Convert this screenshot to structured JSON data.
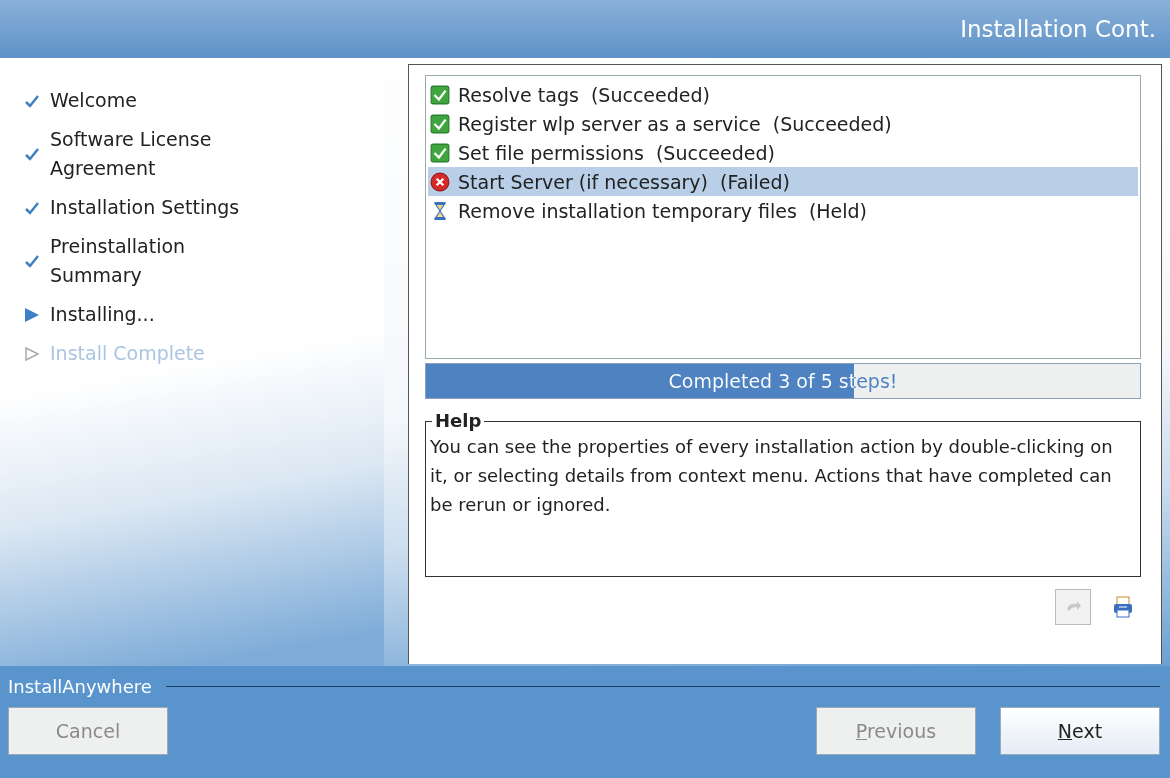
{
  "header": {
    "title": "Installation Cont."
  },
  "steps": [
    {
      "label": "Welcome",
      "kind": "done"
    },
    {
      "label": "Software License Agreement",
      "kind": "done"
    },
    {
      "label": "Installation Settings",
      "kind": "done"
    },
    {
      "label": "Preinstallation Summary",
      "kind": "done"
    },
    {
      "label": "Installing...",
      "kind": "current"
    },
    {
      "label": "Install Complete",
      "kind": "pending"
    }
  ],
  "actions": [
    {
      "label": "Resolve tags  (Succeeded)",
      "kind": "succeeded",
      "selected": false
    },
    {
      "label": "Register wlp server as a service  (Succeeded)",
      "kind": "succeeded",
      "selected": false
    },
    {
      "label": "Set file permissions  (Succeeded)",
      "kind": "succeeded",
      "selected": false
    },
    {
      "label": "Start Server (if necessary)  (Failed)",
      "kind": "failed",
      "selected": true
    },
    {
      "label": "Remove installation temporary files  (Held)",
      "kind": "held",
      "selected": false
    }
  ],
  "progress": {
    "text": "Completed 3 of 5 steps!",
    "level": 0.6
  },
  "help": {
    "title": "Help",
    "text": "You can see the properties of every installation action by double-clicking on it, or selecting details from context menu. Actions that have completed can be rerun or ignored."
  },
  "tools": [
    {
      "kind": "rerun",
      "disabled": true
    },
    {
      "kind": "details",
      "disabled": false
    }
  ],
  "footer": {
    "brand": "InstallAnywhere"
  },
  "buttons": {
    "cancel": {
      "label": "Cancel",
      "disabled": true
    },
    "previous": {
      "label": "Previous",
      "disabled": true
    },
    "next": {
      "label": "Next",
      "disabled": false
    }
  }
}
